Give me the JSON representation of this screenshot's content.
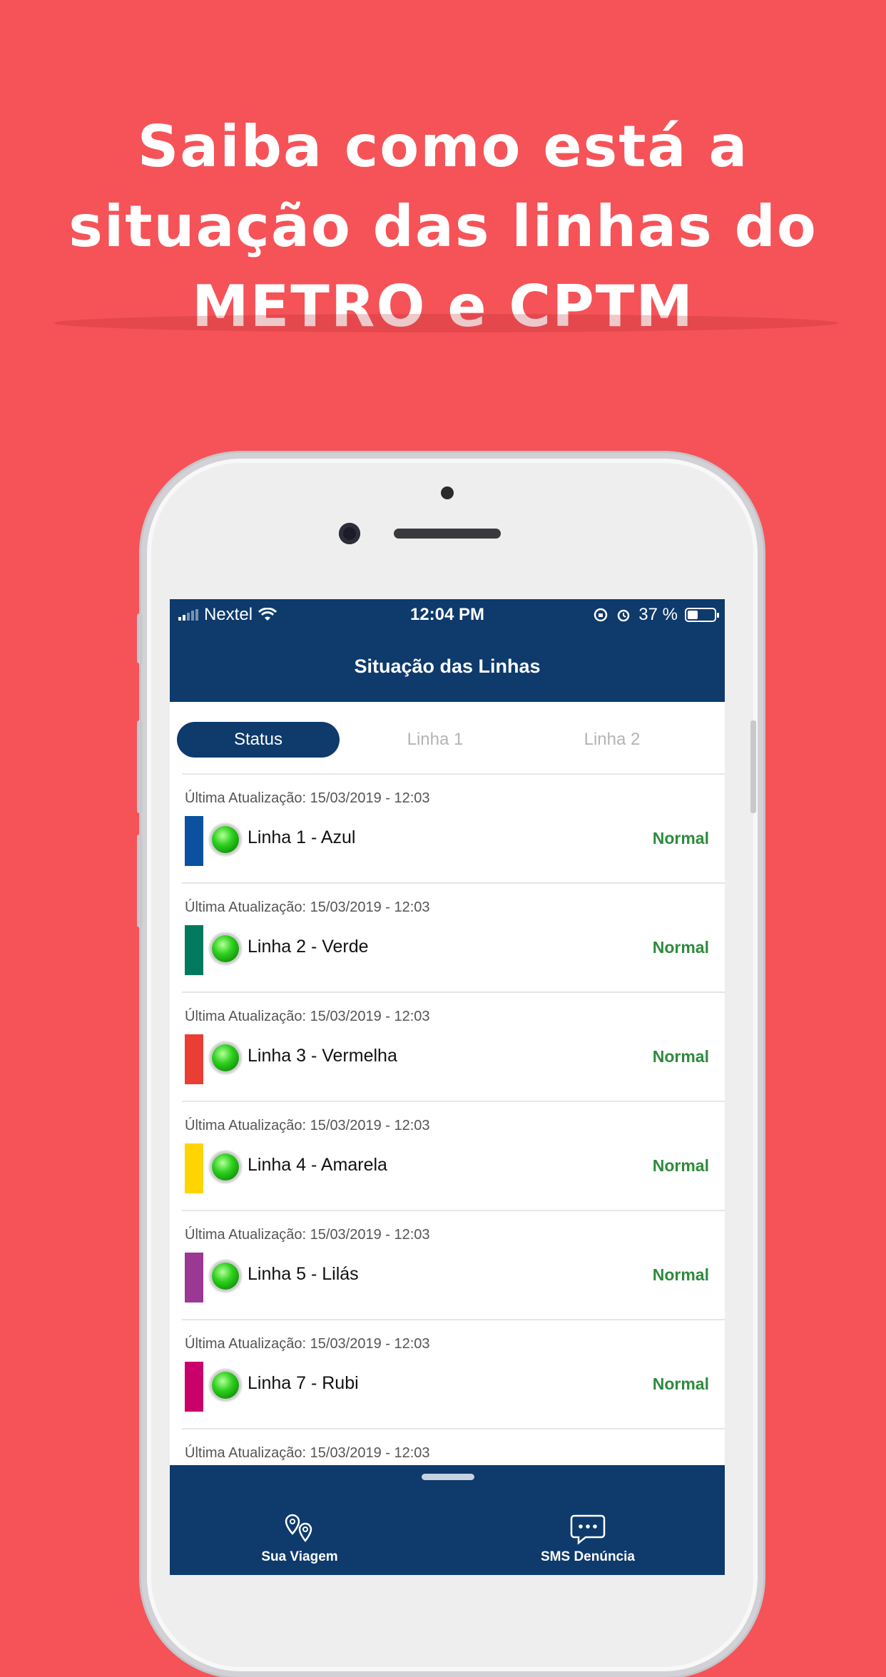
{
  "headline": {
    "line1": "Saiba como está a",
    "line2": "situação das linhas do",
    "line3": "METRO e CPTM"
  },
  "status_bar": {
    "carrier": "Nextel",
    "time": "12:04 PM",
    "battery": "37 %"
  },
  "nav": {
    "title": "Situação das Linhas"
  },
  "tabs": [
    {
      "label": "Status",
      "active": true
    },
    {
      "label": "Linha 1",
      "active": false
    },
    {
      "label": "Linha 2",
      "active": false
    }
  ],
  "lines": [
    {
      "updated": "Última Atualização: 15/03/2019 - 12:03",
      "name": "Linha 1 - Azul",
      "status": "Normal",
      "color": "#0a52a0"
    },
    {
      "updated": "Última Atualização: 15/03/2019 - 12:03",
      "name": "Linha 2 - Verde",
      "status": "Normal",
      "color": "#007a5e"
    },
    {
      "updated": "Última Atualização: 15/03/2019 - 12:03",
      "name": "Linha 3 - Vermelha",
      "status": "Normal",
      "color": "#ea3e35"
    },
    {
      "updated": "Última Atualização: 15/03/2019 - 12:03",
      "name": "Linha 4 - Amarela",
      "status": "Normal",
      "color": "#ffd400"
    },
    {
      "updated": "Última Atualização: 15/03/2019 - 12:03",
      "name": "Linha 5 - Lilás",
      "status": "Normal",
      "color": "#9b3894"
    },
    {
      "updated": "Última Atualização: 15/03/2019 - 12:03",
      "name": "Linha 7 - Rubi",
      "status": "Normal",
      "color": "#ca016b"
    },
    {
      "updated": "Última Atualização: 15/03/2019 - 12:03",
      "name": "",
      "status": "",
      "color": "#9e9e9e"
    }
  ],
  "bottom_nav": {
    "left": {
      "label": "Sua Viagem",
      "icon": "map-pin-icon"
    },
    "right": {
      "label": "SMS Denúncia",
      "icon": "chat-bubble-icon"
    }
  },
  "colors": {
    "background": "#f55358",
    "brand": "#0e3a6c",
    "status_ok": "#2e8b3c"
  }
}
